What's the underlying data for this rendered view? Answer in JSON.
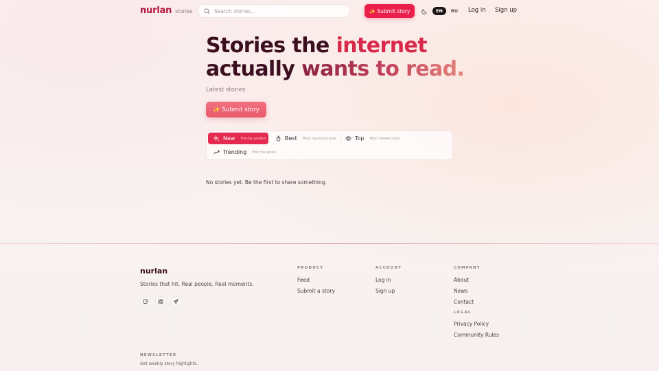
{
  "header": {
    "logo_name": "nurlan",
    "logo_sub": "stories",
    "search_placeholder": "Search stories...",
    "submit_label": "✨ Submit story",
    "languages": [
      {
        "code": "EN",
        "active": true
      },
      {
        "code": "RU",
        "active": false
      }
    ],
    "login_label": "Log in",
    "signup_label": "Sign up"
  },
  "hero": {
    "title_part1": "Stories the ",
    "title_accent1": "internet",
    "title_part2": "actually ",
    "title_accent2": "wants to read.",
    "subtitle": "Latest stories",
    "submit_label": "✨ Submit story"
  },
  "tabs": [
    {
      "label": "New",
      "hint": "Freshly posted",
      "icon": "sparkle-icon",
      "active": true
    },
    {
      "label": "Best",
      "hint": "Most reactions ever",
      "icon": "flame-icon",
      "active": false
    },
    {
      "label": "Top",
      "hint": "Most viewed ever",
      "icon": "eye-icon",
      "active": false
    },
    {
      "label": "Trending",
      "hint": "Hot this week",
      "icon": "trending-up-icon",
      "active": false
    }
  ],
  "empty_message": "No stories yet. Be the first to share something.",
  "footer": {
    "brand": "nurlan",
    "tagline": "Stories that hit. Real people. Real moments.",
    "socials": [
      "twitch-icon",
      "instagram-icon",
      "telegram-icon"
    ],
    "product": {
      "heading": "PRODUCT",
      "links": [
        "Feed",
        "Submit a story"
      ]
    },
    "account": {
      "heading": "ACCOUNT",
      "links": [
        "Log in",
        "Sign up"
      ]
    },
    "company": {
      "heading": "COMPANY",
      "links": [
        "About",
        "News",
        "Contact"
      ]
    },
    "legal": {
      "heading": "LEGAL",
      "links": [
        "Privacy Policy",
        "Community Rules"
      ]
    },
    "newsletter": {
      "heading": "NEWSLETTER",
      "subtitle": "Get weekly story highlights."
    }
  },
  "colors": {
    "brand": "#b3173f",
    "accent": "#ea1f4c",
    "text_dark": "#3b0f1f"
  }
}
